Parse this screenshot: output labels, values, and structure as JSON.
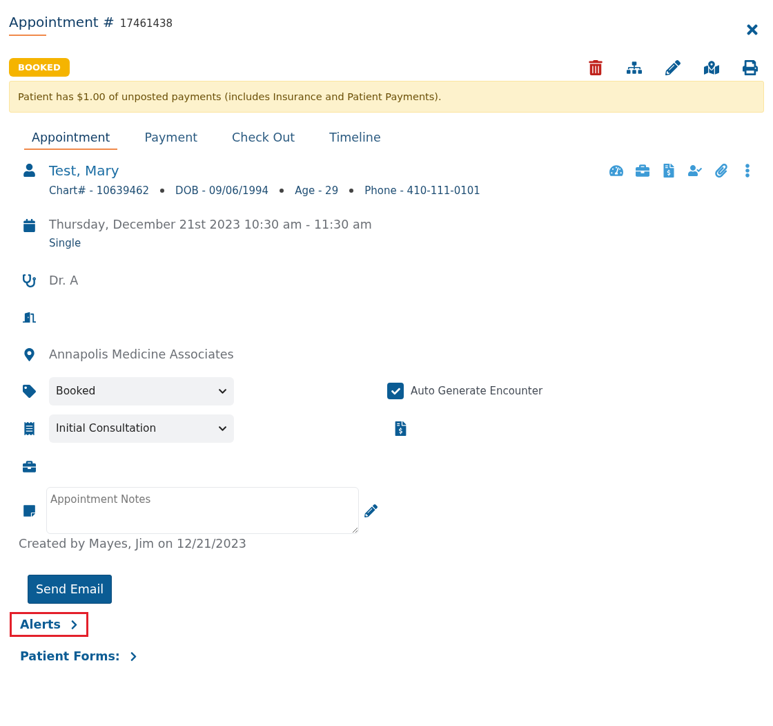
{
  "header": {
    "title": "Appointment #",
    "number": "17461438"
  },
  "status_badge": "BOOKED",
  "alert_banner": "Patient has $1.00 of unposted payments (includes Insurance and Patient Payments).",
  "tabs": [
    {
      "label": "Appointment",
      "selected": true
    },
    {
      "label": "Payment",
      "selected": false
    },
    {
      "label": "Check Out",
      "selected": false
    },
    {
      "label": "Timeline",
      "selected": false
    }
  ],
  "patient": {
    "name": "Test, Mary",
    "details": [
      "Chart# - 10639462",
      "DOB - 09/06/1994",
      "Age - 29",
      "Phone - 410-111-0101"
    ]
  },
  "appointment": {
    "datetime": "Thursday, December 21st 2023 10:30 am - 11:30 am",
    "type": "Single",
    "provider": "Dr. A",
    "location": "Annapolis Medicine Associates"
  },
  "status_select": {
    "value": "Booked"
  },
  "auto_generate_encounter": {
    "label": "Auto Generate Encounter",
    "checked": true
  },
  "visit_type_select": {
    "value": "Initial Consultation"
  },
  "notes": {
    "placeholder": "Appointment Notes"
  },
  "created_by": "Created by Mayes, Jim on 12/21/2023",
  "send_email_button": "Send Email",
  "links": [
    {
      "label": "Alerts",
      "highlighted": true
    },
    {
      "label": "Patient Forms:",
      "highlighted": false
    }
  ]
}
